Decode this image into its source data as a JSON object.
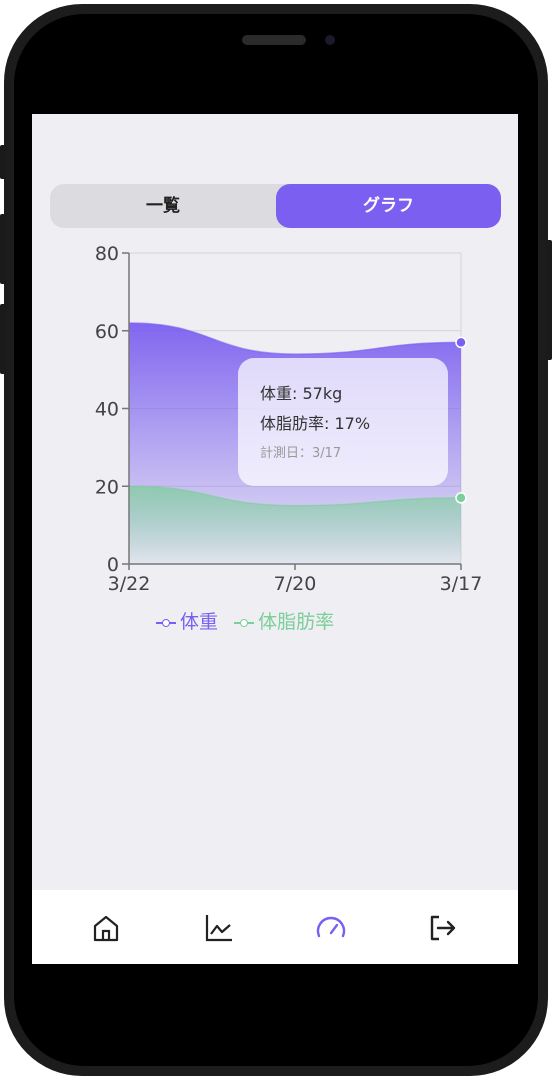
{
  "segmented": {
    "list_label": "一覧",
    "graph_label": "グラフ",
    "active": "グラフ"
  },
  "chart_data": {
    "type": "area",
    "categories": [
      "3/22",
      "7/20",
      "3/17"
    ],
    "series": [
      {
        "name": "体重",
        "values": [
          62,
          54,
          57
        ],
        "color": "#7b5ff0"
      },
      {
        "name": "体脂肪率",
        "values": [
          20,
          15,
          17
        ],
        "color": "#7ccf9a"
      }
    ],
    "ylim": [
      0,
      80
    ],
    "yticks": [
      "0",
      "20",
      "40",
      "60",
      "80"
    ],
    "grid": true,
    "legend_position": "bottom",
    "tooltip": {
      "weight": "体重: 57kg",
      "fat": "体脂肪率: 17%",
      "date": "計測日：3/17"
    }
  },
  "nav": {
    "icons": [
      "home-icon",
      "chart-line-icon",
      "gauge-icon",
      "logout-icon"
    ],
    "active": "gauge-icon"
  }
}
